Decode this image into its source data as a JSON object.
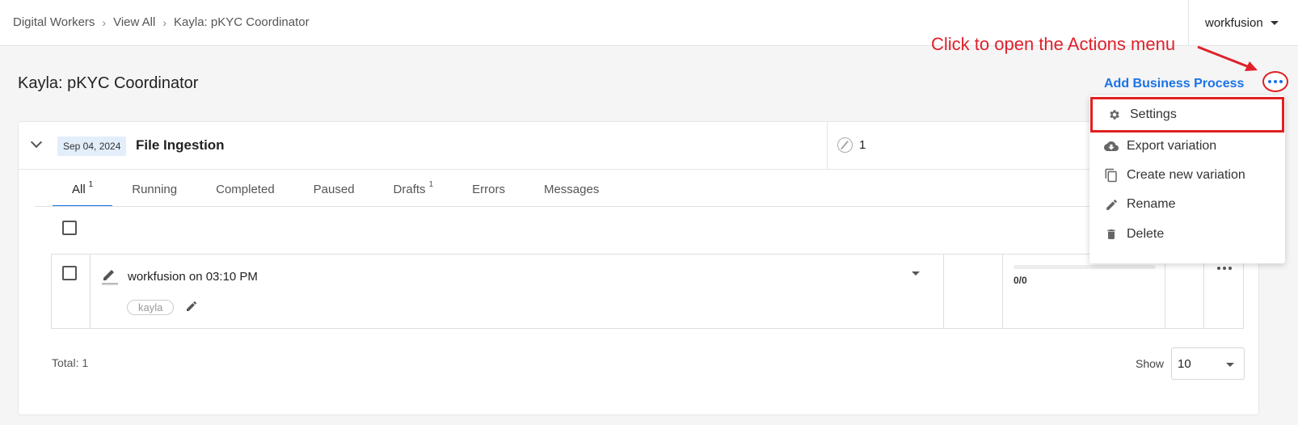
{
  "header": {
    "breadcrumb": [
      "Digital Workers",
      "View All",
      "Kayla: pKYC Coordinator"
    ],
    "user": "workfusion"
  },
  "page": {
    "title": "Kayla: pKYC Coordinator",
    "add_button": "Add Business Process"
  },
  "annotation": {
    "text": "Click to open the Actions menu",
    "color": "#e0202a"
  },
  "process": {
    "date": "Sep 04, 2024",
    "name": "File Ingestion",
    "count": "1"
  },
  "tabs": [
    {
      "label": "All",
      "count": "1",
      "active": true
    },
    {
      "label": "Running",
      "count": "",
      "active": false
    },
    {
      "label": "Completed",
      "count": "",
      "active": false
    },
    {
      "label": "Paused",
      "count": "",
      "active": false
    },
    {
      "label": "Drafts",
      "count": "1",
      "active": false
    },
    {
      "label": "Errors",
      "count": "",
      "active": false
    },
    {
      "label": "Messages",
      "count": "",
      "active": false
    }
  ],
  "row": {
    "title": "workfusion on  03:10 PM",
    "tag": "kayla",
    "progress_text": "0/0",
    "progress_fraction": 0
  },
  "footer": {
    "total": "Total: 1",
    "show_label": "Show",
    "page_size": "10"
  },
  "menu": {
    "items": [
      {
        "label": "Settings",
        "icon": "gear-icon"
      },
      {
        "label": "Export variation",
        "icon": "cloud-download-icon"
      },
      {
        "label": "Create new variation",
        "icon": "copy-icon"
      },
      {
        "label": "Rename",
        "icon": "pencil-icon"
      },
      {
        "label": "Delete",
        "icon": "trash-icon"
      }
    ]
  },
  "colors": {
    "accent": "#1a73e8",
    "annotation": "#e02020"
  }
}
